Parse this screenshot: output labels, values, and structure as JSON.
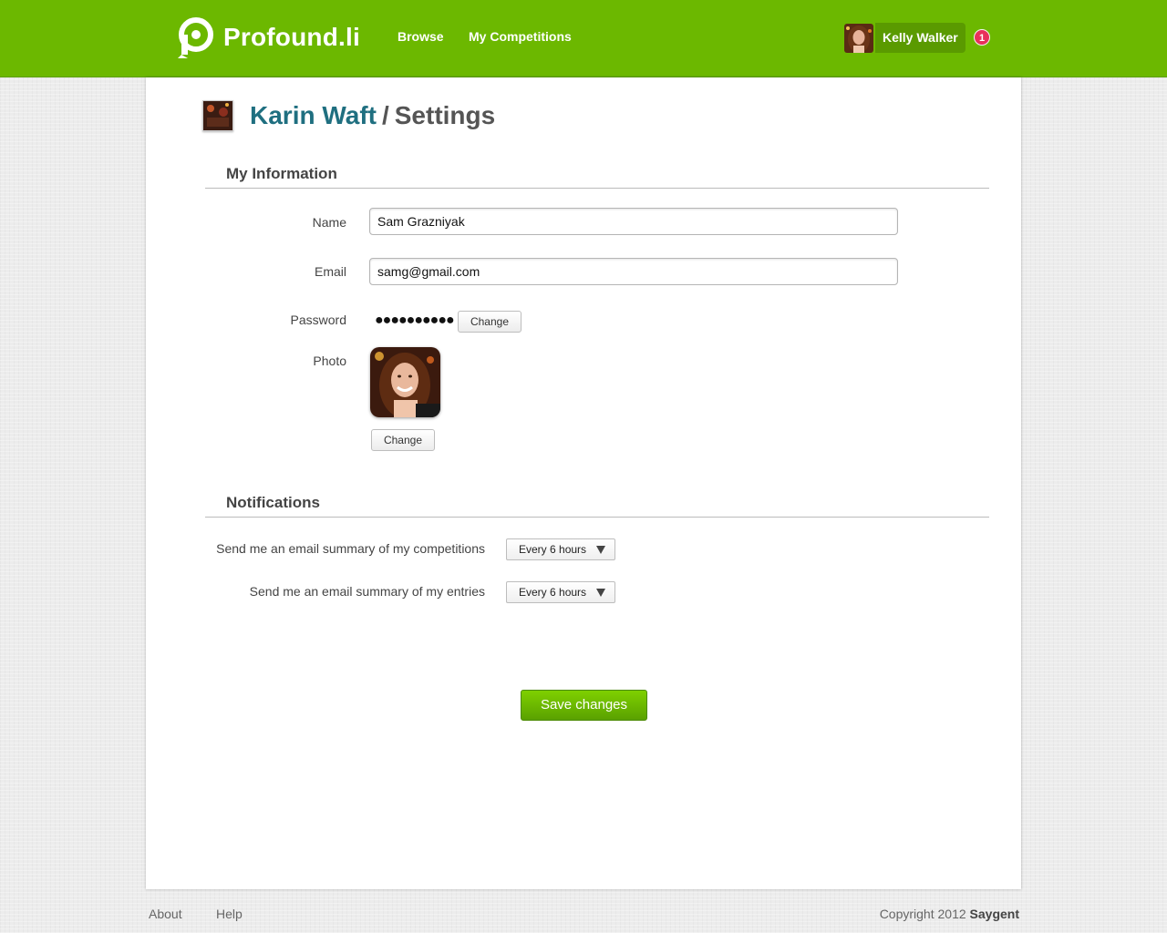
{
  "brand": {
    "name": "Profound.li",
    "color": "#6cb800"
  },
  "nav": {
    "browse": "Browse",
    "my_competitions": "My Competitions"
  },
  "user": {
    "name": "Kelly Walker",
    "notification_count": "1"
  },
  "page": {
    "owner": "Karin Waft",
    "separator": "/",
    "title": "Settings"
  },
  "my_information": {
    "heading": "My Information",
    "name_label": "Name",
    "name_value": "Sam Grazniyak",
    "email_label": "Email",
    "email_value": "samg@gmail.com",
    "password_label": "Password",
    "password_mask": "●●●●●●●●●●",
    "password_change": "Change",
    "photo_label": "Photo",
    "photo_change": "Change"
  },
  "notifications": {
    "heading": "Notifications",
    "competitions_label": "Send me an email summary of my competitions",
    "competitions_value": "Every 6 hours",
    "entries_label": "Send me an email summary of my entries",
    "entries_value": "Every 6 hours"
  },
  "actions": {
    "save": "Save changes"
  },
  "footer": {
    "about": "About",
    "help": "Help",
    "copyright": "Copyright 2012",
    "company": "Saygent"
  }
}
